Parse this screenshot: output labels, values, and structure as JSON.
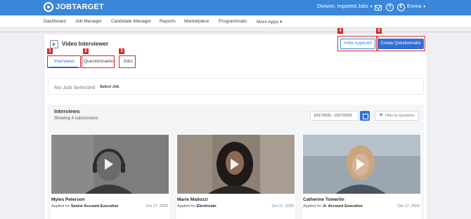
{
  "header": {
    "logo_text": "JOBTARGET",
    "division_label": "Division: Imported Jobs",
    "user_initial": "E",
    "user_name": "Emma"
  },
  "nav": {
    "items": [
      "Dashboard",
      "Job Manager",
      "Candidate Manager",
      "Reports",
      "Marketplace",
      "Programmatic",
      "More Apps"
    ]
  },
  "page": {
    "title": "Video Interviewer",
    "invite_label": "Invite Applicant",
    "create_label": "Create Questionnaire",
    "tabs": [
      "Interviews",
      "Questionnaires",
      "Jobs"
    ],
    "no_job_text": "No Job Selected",
    "select_job_label": "Select Job"
  },
  "annotations": [
    "1",
    "2",
    "3",
    "4",
    "5"
  ],
  "interviews": {
    "title": "Interviews",
    "subtitle": "Showing 4 submissions",
    "date_range": "10/17/2025 - 10/17/2025",
    "filter_placeholder": "Filter by Questions",
    "applied_for_prefix": "Applied for",
    "cards": [
      {
        "name": "Myles Peterson",
        "position": "Senior Account Executive",
        "date": "Oct 17, 2025"
      },
      {
        "name": "Marie Maliozzi",
        "position": "Electrician",
        "date": "Oct 17, 2025"
      },
      {
        "name": "Catherine Tomerlin",
        "position": "Jr. Account Executive",
        "date": "Oct 17, 2025"
      }
    ]
  },
  "colors": {
    "brand_blue": "#3a86d8",
    "primary_button": "#2f6fd6",
    "annotation_red": "#d12b2b"
  }
}
